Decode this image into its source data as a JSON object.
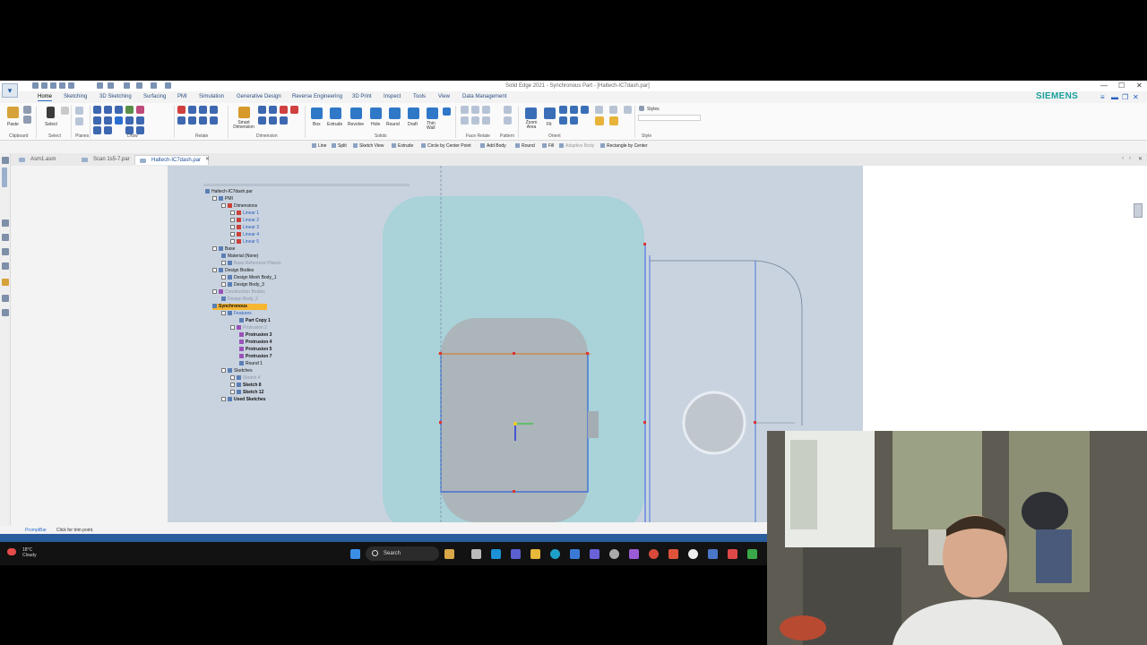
{
  "window": {
    "title": "Solid Edge 2021 - Synchronous Part - [Haltech-IC7dash.par]",
    "brand": "SIEMENS",
    "accent": "#199f9c"
  },
  "ribbon_tabs": [
    "Home",
    "Sketching",
    "3D Sketching",
    "Surfacing",
    "PMI",
    "Simulation",
    "Generative Design",
    "Reverse Engineering",
    "3D Print",
    "Inspect",
    "Tools",
    "View",
    "Data Management"
  ],
  "ribbon": {
    "buttons": {
      "paste": "Paste",
      "select": "Select",
      "smart_dimension": "Smart Dimension",
      "box": "Box",
      "extrude": "Extrude",
      "revolve": "Revolve",
      "hole": "Hole",
      "round": "Round",
      "draft": "Draft",
      "thin_wall": "Thin Wall",
      "zoom_area": "Zoom Area",
      "fit": "Fit",
      "styles": "Styles"
    },
    "groups": {
      "clipboard": "Clipboard",
      "select": "Select",
      "planes": "Planes",
      "draw": "Draw",
      "relate": "Relate",
      "dimension": "Dimension",
      "solids": "Solids",
      "face_relate": "Face Relate",
      "pattern": "Pattern",
      "orient": "Orient",
      "style": "Style"
    }
  },
  "command_bar": [
    "Line",
    "Split",
    "Sketch View",
    "Extrude",
    "Circle by Center Point",
    "Add Body",
    "Round",
    "Fill",
    "Adaptive Body",
    "Rectangle by Center"
  ],
  "document_tabs": [
    {
      "label": "Asm1.asm",
      "active": false
    },
    {
      "label": "Scan 1s5-7.par",
      "active": false
    },
    {
      "label": "Haltech-IC7dash.par",
      "active": true
    }
  ],
  "tree": {
    "root": "Haltech-IC7dash.par",
    "pmi": "PMI",
    "dimensions": "Dimensions",
    "linears": [
      "Linear 1",
      "Linear 2",
      "Linear 3",
      "Linear 4",
      "Linear 5"
    ],
    "base": "Base",
    "material": "Material (None)",
    "base_reference_planes": "Base Reference Planes",
    "design_bodies": "Design Bodies",
    "design_mesh_body": "Design Mesh Body_1",
    "design_body_3": "Design Body_3",
    "construction_bodies": "Construction Bodies",
    "design_body_2": "Design Body_2",
    "synchronous": "Synchronous",
    "features": "Features",
    "part_copy": "Part Copy 1",
    "protrusions": [
      "Protrusion 2",
      "Protrusion 3",
      "Protrusion 4",
      "Protrusion 5",
      "Protrusion 7"
    ],
    "round1": "Round 1",
    "sketches": "Sketches",
    "sketch_items": [
      "Sketch 4",
      "Sketch 8",
      "Sketch 12"
    ],
    "used_sketches": "Used Sketches"
  },
  "status": {
    "prompt_title": "PromptBar",
    "prompt_message": "Click for trim point."
  },
  "taskbar": {
    "temperature": "18°C",
    "condition": "Cloudy",
    "search": "Search"
  }
}
